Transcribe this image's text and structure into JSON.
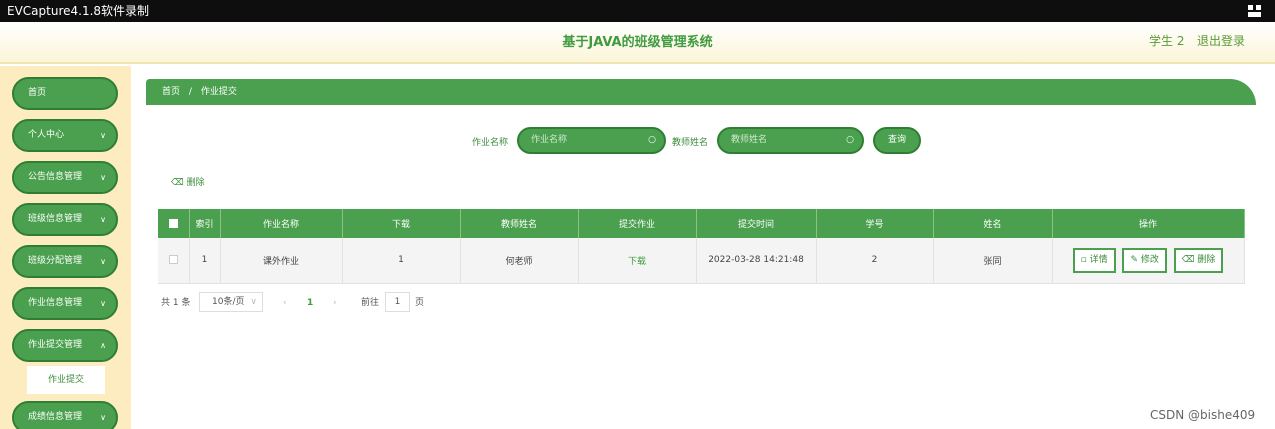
{
  "recorder": {
    "title": "EVCapture4.1.8软件录制"
  },
  "header": {
    "title": "基于JAVA的班级管理系统",
    "user": "学生 2",
    "logout": "退出登录"
  },
  "sidebar": {
    "items": [
      {
        "label": "首页"
      },
      {
        "label": "个人中心"
      },
      {
        "label": "公告信息管理"
      },
      {
        "label": "班级信息管理"
      },
      {
        "label": "班级分配管理"
      },
      {
        "label": "作业信息管理"
      },
      {
        "label": "作业提交管理"
      },
      {
        "label": "成绩信息管理"
      }
    ],
    "sub_item": "作业提交"
  },
  "breadcrumb": {
    "home": "首页",
    "sep": "/",
    "current": "作业提交"
  },
  "search": {
    "field1_label": "作业名称",
    "field1_placeholder": "作业名称",
    "field2_label": "教师姓名",
    "field2_placeholder": "教师姓名",
    "query_label": "查询"
  },
  "toolbar": {
    "delete_label": "删除"
  },
  "table": {
    "headers": [
      "索引",
      "作业名称",
      "下载",
      "教师姓名",
      "提交作业",
      "提交时间",
      "学号",
      "姓名",
      "操作"
    ],
    "rows": [
      {
        "index": "1",
        "name": "课外作业",
        "download": "1",
        "teacher": "何老师",
        "submit": "下载",
        "time": "2022-03-28 14:21:48",
        "student_no": "2",
        "student_name": "张同",
        "actions": {
          "detail": "详情",
          "edit": "修改",
          "delete": "删除"
        }
      }
    ]
  },
  "pagination": {
    "total": "共 1 条",
    "page_size": "10条/页",
    "current": "1",
    "goto_prefix": "前往",
    "goto_value": "1",
    "goto_suffix": "页"
  },
  "watermark": "CSDN @bishe409",
  "colors": {
    "primary": "#4aa04e",
    "border": "#2f7e34",
    "sidebar_bg": "#fcecbf"
  }
}
